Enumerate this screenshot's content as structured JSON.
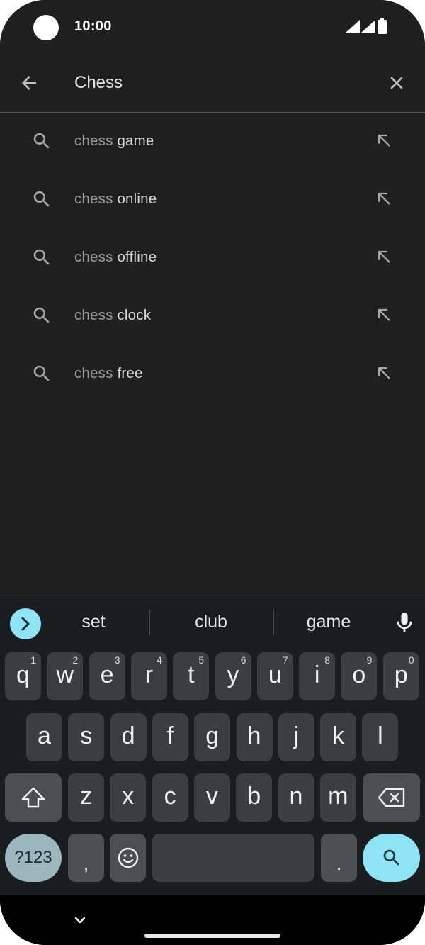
{
  "status_bar": {
    "time": "10:00"
  },
  "search": {
    "query": "Chess"
  },
  "suggestions": [
    {
      "prefix": "chess",
      "rest": " game"
    },
    {
      "prefix": "chess",
      "rest": " online"
    },
    {
      "prefix": "chess",
      "rest": " offline"
    },
    {
      "prefix": "chess",
      "rest": " clock"
    },
    {
      "prefix": "chess",
      "rest": " free"
    }
  ],
  "keyboard": {
    "word_suggestions": [
      "set",
      "club",
      "game"
    ],
    "row1": [
      "q",
      "w",
      "e",
      "r",
      "t",
      "y",
      "u",
      "i",
      "o",
      "p"
    ],
    "row1_hints": [
      "1",
      "2",
      "3",
      "4",
      "5",
      "6",
      "7",
      "8",
      "9",
      "0"
    ],
    "row2": [
      "a",
      "s",
      "d",
      "f",
      "g",
      "h",
      "j",
      "k",
      "l"
    ],
    "row3": [
      "z",
      "x",
      "c",
      "v",
      "b",
      "n",
      "m"
    ],
    "symbols_label": "?123",
    "comma": ",",
    "period": "."
  },
  "colors": {
    "accent": "#8ee3f5",
    "background": "#1f1f1f",
    "keyboard": "#1a1d20"
  }
}
